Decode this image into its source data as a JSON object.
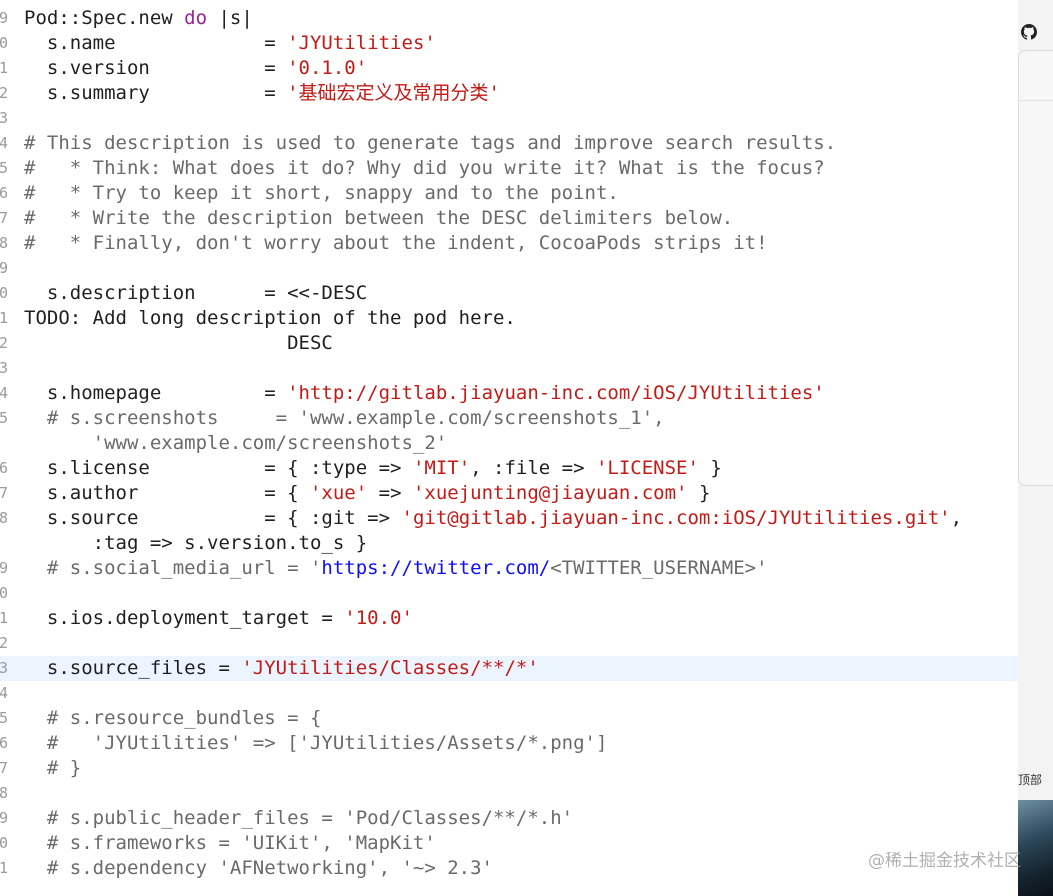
{
  "editor": {
    "lines": [
      {
        "gutter": "9",
        "segments": [
          {
            "t": "Pod::Spec.new ",
            "c": "plain"
          },
          {
            "t": "do",
            "c": "kw"
          },
          {
            "t": " |s|",
            "c": "plain"
          }
        ]
      },
      {
        "gutter": "0",
        "segments": [
          {
            "t": "  s.name             = ",
            "c": "plain"
          },
          {
            "t": "'JYUtilities'",
            "c": "str"
          }
        ]
      },
      {
        "gutter": "1",
        "segments": [
          {
            "t": "  s.version          = ",
            "c": "plain"
          },
          {
            "t": "'0.1.0'",
            "c": "str"
          }
        ]
      },
      {
        "gutter": "2",
        "segments": [
          {
            "t": "  s.summary          = ",
            "c": "plain"
          },
          {
            "t": "'基础宏定义及常用分类'",
            "c": "str"
          }
        ]
      },
      {
        "gutter": "3",
        "segments": []
      },
      {
        "gutter": "4",
        "segments": [
          {
            "t": "# This description is used to generate tags and improve search results.",
            "c": "cm"
          }
        ]
      },
      {
        "gutter": "5",
        "segments": [
          {
            "t": "#   * Think: What does it do? Why did you write it? What is the focus?",
            "c": "cm"
          }
        ]
      },
      {
        "gutter": "6",
        "segments": [
          {
            "t": "#   * Try to keep it short, snappy and to the point.",
            "c": "cm"
          }
        ]
      },
      {
        "gutter": "7",
        "segments": [
          {
            "t": "#   * Write the description between the DESC delimiters below.",
            "c": "cm"
          }
        ]
      },
      {
        "gutter": "8",
        "segments": [
          {
            "t": "#   * Finally, don't worry about the indent, CocoaPods strips it!",
            "c": "cm"
          }
        ]
      },
      {
        "gutter": "9",
        "segments": []
      },
      {
        "gutter": "0",
        "segments": [
          {
            "t": "  s.description      = <<-DESC",
            "c": "plain"
          }
        ]
      },
      {
        "gutter": "1",
        "segments": [
          {
            "t": "TODO: Add long description of the pod here.",
            "c": "plain"
          }
        ]
      },
      {
        "gutter": "2",
        "segments": [
          {
            "t": "                       DESC",
            "c": "plain"
          }
        ]
      },
      {
        "gutter": "3",
        "segments": []
      },
      {
        "gutter": "4",
        "segments": [
          {
            "t": "  s.homepage         = ",
            "c": "plain"
          },
          {
            "t": "'http://gitlab.jiayuan-inc.com/iOS/JYUtilities'",
            "c": "str"
          }
        ]
      },
      {
        "gutter": "5",
        "segments": [
          {
            "t": "  # s.screenshots     = 'www.example.com/screenshots_1',",
            "c": "cm"
          }
        ]
      },
      {
        "gutter": "",
        "segments": [
          {
            "t": "      'www.example.com/screenshots_2'",
            "c": "cm"
          }
        ]
      },
      {
        "gutter": "6",
        "segments": [
          {
            "t": "  s.license          = { :type => ",
            "c": "plain"
          },
          {
            "t": "'MIT'",
            "c": "str"
          },
          {
            "t": ", :file => ",
            "c": "plain"
          },
          {
            "t": "'LICENSE'",
            "c": "str"
          },
          {
            "t": " }",
            "c": "plain"
          }
        ]
      },
      {
        "gutter": "7",
        "segments": [
          {
            "t": "  s.author           = { ",
            "c": "plain"
          },
          {
            "t": "'xue'",
            "c": "str"
          },
          {
            "t": " => ",
            "c": "plain"
          },
          {
            "t": "'xuejunting@jiayuan.com'",
            "c": "str"
          },
          {
            "t": " }",
            "c": "plain"
          }
        ]
      },
      {
        "gutter": "8",
        "segments": [
          {
            "t": "  s.source           = { :git => ",
            "c": "plain"
          },
          {
            "t": "'git@gitlab.jiayuan-inc.com:iOS/JYUtilities.git'",
            "c": "str"
          },
          {
            "t": ",",
            "c": "plain"
          }
        ]
      },
      {
        "gutter": "",
        "segments": [
          {
            "t": "      :tag => s.version.to_s }",
            "c": "plain"
          }
        ]
      },
      {
        "gutter": "9",
        "segments": [
          {
            "t": "  # s.social_media_url = '",
            "c": "cm"
          },
          {
            "t": "https://twitter.com/",
            "c": "url"
          },
          {
            "t": "<TWITTER_USERNAME>'",
            "c": "cm"
          }
        ]
      },
      {
        "gutter": "0",
        "segments": []
      },
      {
        "gutter": "1",
        "segments": [
          {
            "t": "  s.ios.deployment_target = ",
            "c": "plain"
          },
          {
            "t": "'10.0'",
            "c": "str"
          }
        ]
      },
      {
        "gutter": "2",
        "segments": []
      },
      {
        "gutter": "3",
        "current": true,
        "segments": [
          {
            "t": "  s.source_files = ",
            "c": "plain"
          },
          {
            "t": "'JYUtilities/Classes/**/*'",
            "c": "str"
          }
        ]
      },
      {
        "gutter": "4",
        "segments": []
      },
      {
        "gutter": "5",
        "segments": [
          {
            "t": "  # s.resource_bundles = {",
            "c": "cm"
          }
        ]
      },
      {
        "gutter": "6",
        "segments": [
          {
            "t": "  #   'JYUtilities' => ['JYUtilities/Assets/*.png']",
            "c": "cm"
          }
        ]
      },
      {
        "gutter": "7",
        "segments": [
          {
            "t": "  # }",
            "c": "cm"
          }
        ]
      },
      {
        "gutter": "8",
        "segments": []
      },
      {
        "gutter": "9",
        "segments": [
          {
            "t": "  # s.public_header_files = 'Pod/Classes/**/*.h'",
            "c": "cm"
          }
        ]
      },
      {
        "gutter": "0",
        "segments": [
          {
            "t": "  # s.frameworks = 'UIKit', 'MapKit'",
            "c": "cm"
          }
        ]
      },
      {
        "gutter": "1",
        "segments": [
          {
            "t": "  # s.dependency 'AFNetworking', '~> 2.3'",
            "c": "cm"
          }
        ]
      }
    ]
  },
  "side": {
    "top_label": "顶部",
    "github_icon": "github-icon"
  },
  "watermark": "@稀土掘金技术社区",
  "colors": {
    "keyword": "#9b2393",
    "string": "#c41a16",
    "comment": "#6a6a6a",
    "url": "#0e0eff",
    "current_line": "#ecf5ff"
  }
}
